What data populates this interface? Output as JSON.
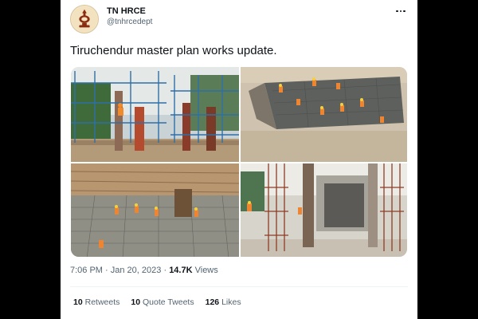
{
  "tweet": {
    "author_name": "TN HRCE",
    "author_handle": "@tnhrcedept",
    "text": "Tiruchendur master plan works update.",
    "time": "7:06 PM",
    "separator": "·",
    "date": "Jan 20, 2023",
    "views_count": "14.7K",
    "views_label": "Views"
  },
  "stats": {
    "retweets_count": "10",
    "retweets_label": "Retweets",
    "quotes_count": "10",
    "quotes_label": "Quote Tweets",
    "likes_count": "126",
    "likes_label": "Likes"
  },
  "icons": {
    "avatar": "temple-lamp-logo",
    "more": "more-horizontal-icon"
  },
  "colors": {
    "card_background": "#ffffff",
    "outer_background": "#000000",
    "text_primary": "#0f1419",
    "text_secondary": "#536471"
  }
}
